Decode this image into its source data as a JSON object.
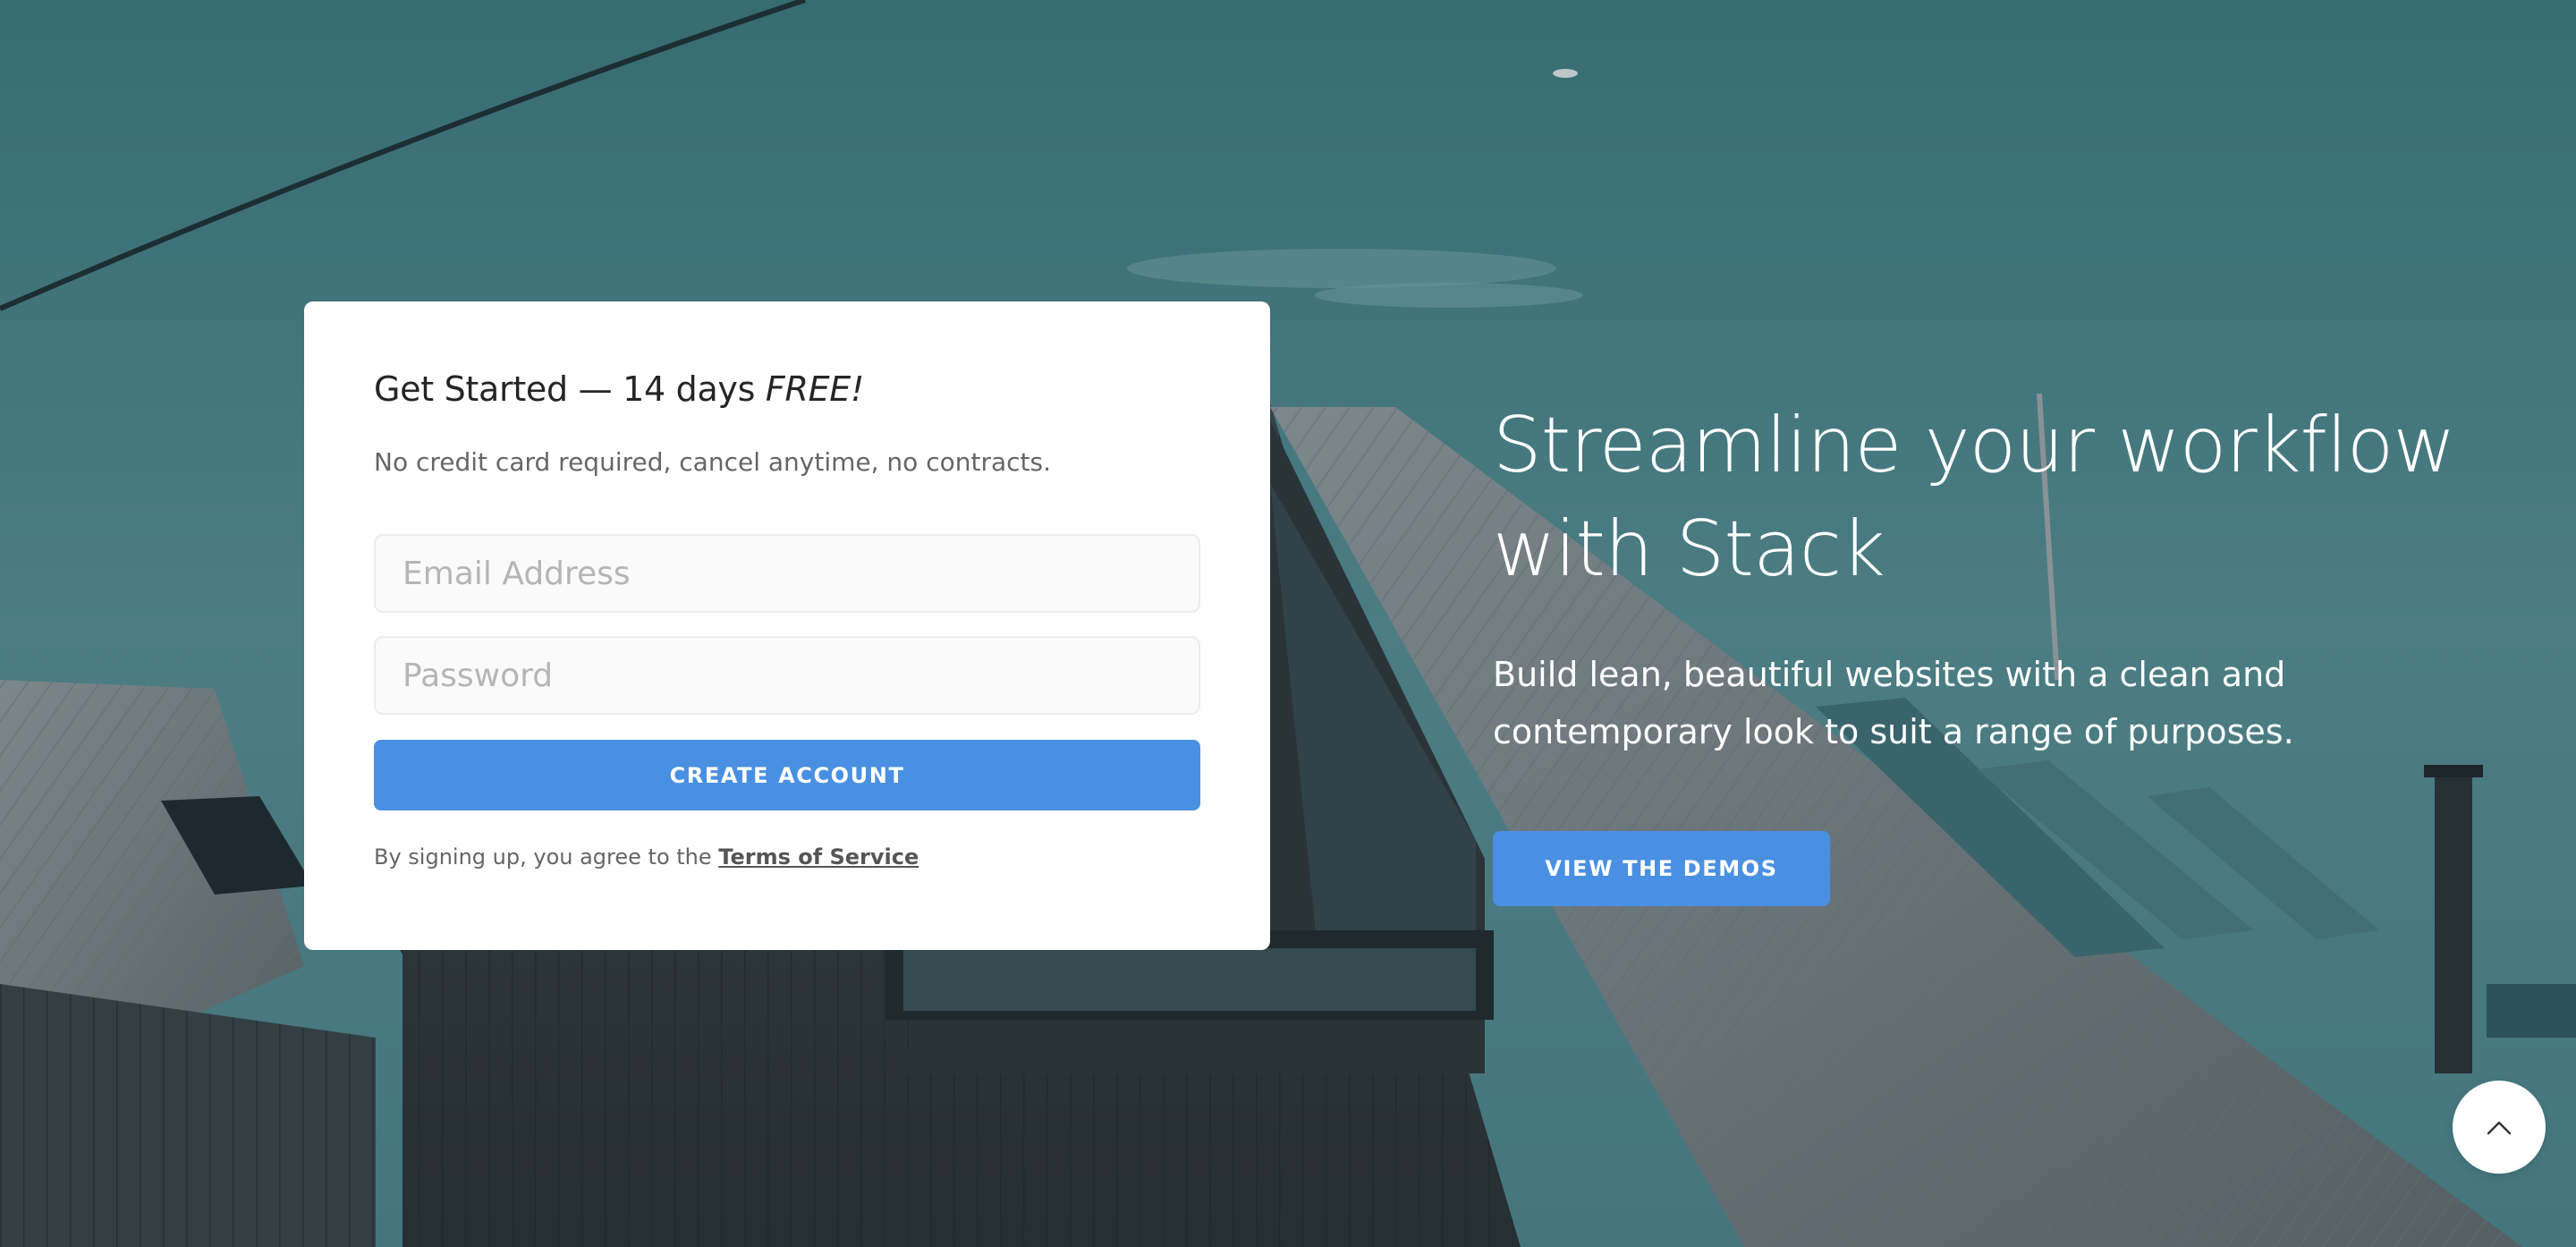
{
  "signup_card": {
    "title_main": "Get Started — 14 days ",
    "title_emphasis": "FREE!",
    "subtitle": "No credit card required, cancel anytime, no contracts.",
    "email_placeholder": "Email Address",
    "password_placeholder": "Password",
    "submit_label": "CREATE ACCOUNT",
    "terms_prefix": "By signing up, you agree to the ",
    "terms_link": "Terms of Service"
  },
  "hero": {
    "headline": "Streamline your workflow with Stack",
    "lead": "Build lean, beautiful websites with a clean and contemporary look to suit a range of purposes.",
    "cta_label": "VIEW THE DEMOS"
  },
  "back_to_top": {
    "icon": "chevron-up-icon"
  },
  "colors": {
    "accent": "#4a90e2",
    "card_bg": "#ffffff",
    "sky": "#4e8a8f"
  }
}
